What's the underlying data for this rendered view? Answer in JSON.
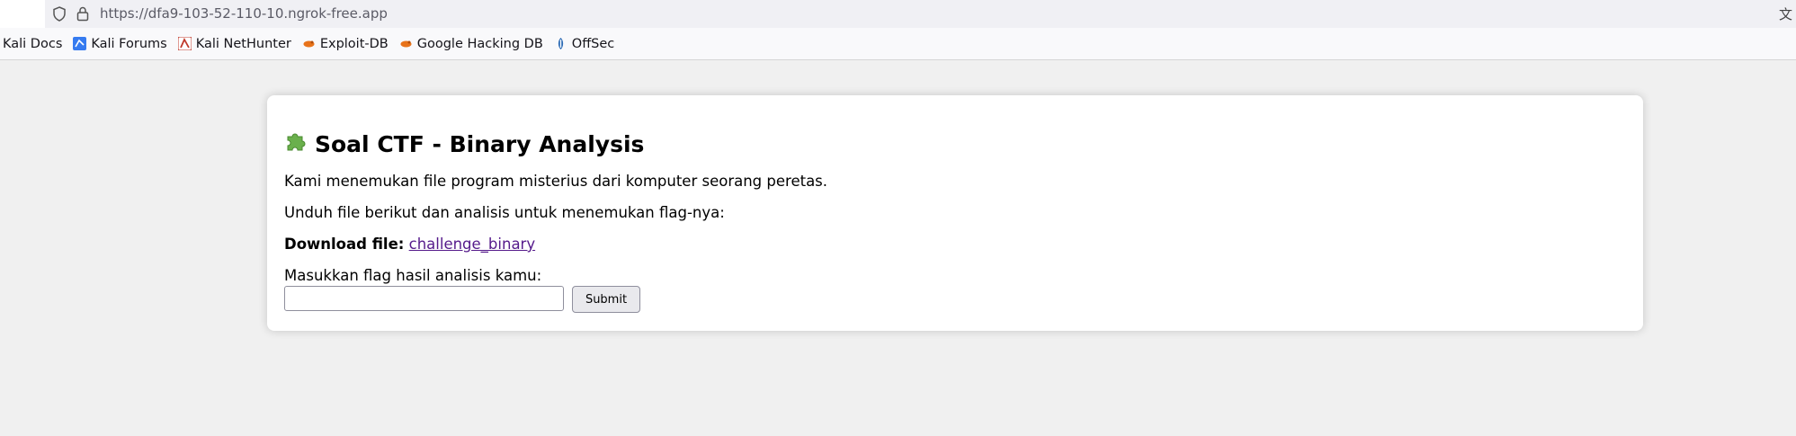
{
  "browser": {
    "url": "https://dfa9-103-52-110-10.ngrok-free.app",
    "bookmarks": [
      {
        "label": "Kali Docs",
        "icon": "kali-docs-icon"
      },
      {
        "label": "Kali Forums",
        "icon": "kali-forums-icon"
      },
      {
        "label": "Kali NetHunter",
        "icon": "kali-nethunter-icon"
      },
      {
        "label": "Exploit-DB",
        "icon": "exploit-db-icon"
      },
      {
        "label": "Google Hacking DB",
        "icon": "google-hacking-db-icon"
      },
      {
        "label": "OffSec",
        "icon": "offsec-icon"
      }
    ]
  },
  "page": {
    "title": "Soal CTF - Binary Analysis",
    "intro": "Kami menemukan file program misterius dari komputer seorang peretas.",
    "instruction": "Unduh file berikut dan analisis untuk menemukan flag-nya:",
    "download_label": "Download file:",
    "download_link": "challenge_binary",
    "flag_prompt": "Masukkan flag hasil analisis kamu:",
    "flag_input_value": "",
    "submit_label": "Submit"
  },
  "colors": {
    "page_bg": "#f0f0f0",
    "card_bg": "#ffffff",
    "link": "#551a8b",
    "puzzle_icon": "#6ab04c"
  }
}
